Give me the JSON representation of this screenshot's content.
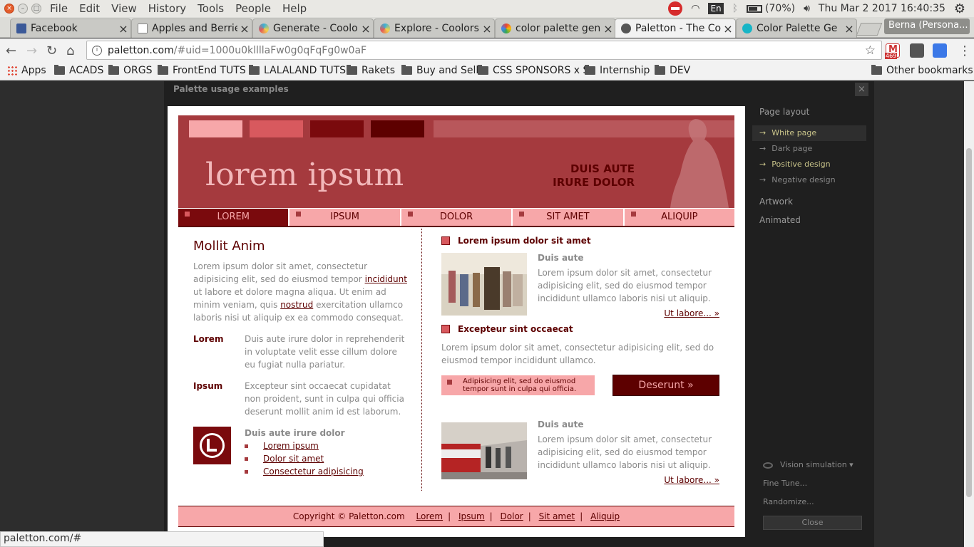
{
  "os": {
    "menus": [
      "File",
      "Edit",
      "View",
      "History",
      "Tools",
      "People",
      "Help"
    ],
    "lang": "En",
    "battery": "(70%)",
    "clock": "Thu Mar  2 2017 16:40:35"
  },
  "tabs": [
    {
      "title": "Facebook",
      "color": "#3b5998"
    },
    {
      "title": "Apples and Berrie",
      "color": "#cccccc"
    },
    {
      "title": "Generate - Coolo",
      "color": "#3ab0d8"
    },
    {
      "title": "Explore - Coolors",
      "color": "#3ab0d8"
    },
    {
      "title": "color palette gen",
      "color": "#4285f4"
    },
    {
      "title": "Paletton - The Co",
      "color": "#555555"
    },
    {
      "title": "Color Palette Ge",
      "color": "#17b5c6"
    }
  ],
  "profile": "Berna (Persona...",
  "address": {
    "host": "paletton.com",
    "path": "/#uid=1000u0kllllaFw0g0qFqFg0w0aF"
  },
  "extensions": {
    "gmail_count": "469"
  },
  "bookmarks": [
    "Apps",
    "ACADS",
    "ORGS",
    "FrontEnd TUTS",
    "LALALAND TUTS",
    "Rakets",
    "Buy and Sell",
    "CSS SPONSORS x S",
    "Internship",
    "DEV",
    "Other bookmarks"
  ],
  "dialog": {
    "title": "Palette usage examples",
    "close": "×"
  },
  "colors": {
    "c1": "#f7a7a9",
    "c2": "#d8595e",
    "c3": "#7a0a0d",
    "c4": "#5d0000",
    "header": "#a53a3e"
  },
  "preview": {
    "header_title": "lorem ipsum",
    "header_sub1": "DUIS AUTE",
    "header_sub2": "IRURE DOLOR",
    "nav": [
      "LOREM",
      "IPSUM",
      "DOLOR",
      "SIT AMET",
      "ALIQUIP"
    ],
    "left": {
      "heading": "Mollit Anim",
      "p1_a": "Lorem ipsum dolor sit amet, consectetur adipisicing elit, sed do eiusmod tempor ",
      "p1_link1": "incididunt",
      "p1_b": " ut labore et dolore magna aliqua. Ut enim ad minim veniam, quis ",
      "p1_link2": "nostrud",
      "p1_c": " exercitation ullamco laboris nisi ut aliquip ex ea commodo consequat.",
      "def1_term": "Lorem",
      "def1_text": "Duis aute irure dolor in reprehenderit in voluptate velit esse cillum dolore eu fugiat nulla pariatur.",
      "def2_term": "Ipsum",
      "def2_text": "Excepteur sint occaecat cupidatat non proident, sunt in culpa qui officia deserunt mollit anim id est laborum.",
      "list_title": "Duis aute irure dolor",
      "list": [
        "Lorem ipsum",
        "Dolor sit amet",
        "Consectetur adipisicing"
      ]
    },
    "right": {
      "head1": "Lorem ipsum dolor sit amet",
      "art1_sub": "Duis aute",
      "art1_text": "Lorem ipsum dolor sit amet, consectetur adipisicing elit, sed do eiusmod tempor incididunt ullamco laboris nisi ut aliquip.",
      "more": "Ut labore... »",
      "head2": "Excepteur sint occaecat",
      "p2": "Lorem ipsum dolor sit amet, consectetur adipisicing elit, sed do eiusmod tempor incididunt ullamco.",
      "callout": "Adipisicing elit, sed do eiusmod tempor sunt in culpa qui officia.",
      "button": "Deserunt »",
      "art2_sub": "Duis aute",
      "art2_text": "Lorem ipsum dolor sit amet, consectetur adipisicing elit, sed do eiusmod tempor incididunt ullamco laboris nisi ut aliquip."
    },
    "footer": {
      "copy": "Copyright © Paletton.com",
      "links": [
        "Lorem",
        "Ipsum",
        "Dolor",
        "Sit amet",
        "Aliquip"
      ]
    }
  },
  "side": {
    "page_layout": "Page layout",
    "options": [
      "White page",
      "Dark page",
      "Positive design",
      "Negative design"
    ],
    "selected": "White page",
    "artwork": "Artwork",
    "animated": "Animated",
    "vision": "Vision simulation",
    "fine_tune": "Fine Tune...",
    "randomize": "Randomize...",
    "close": "Close"
  },
  "status": "paletton.com/#"
}
